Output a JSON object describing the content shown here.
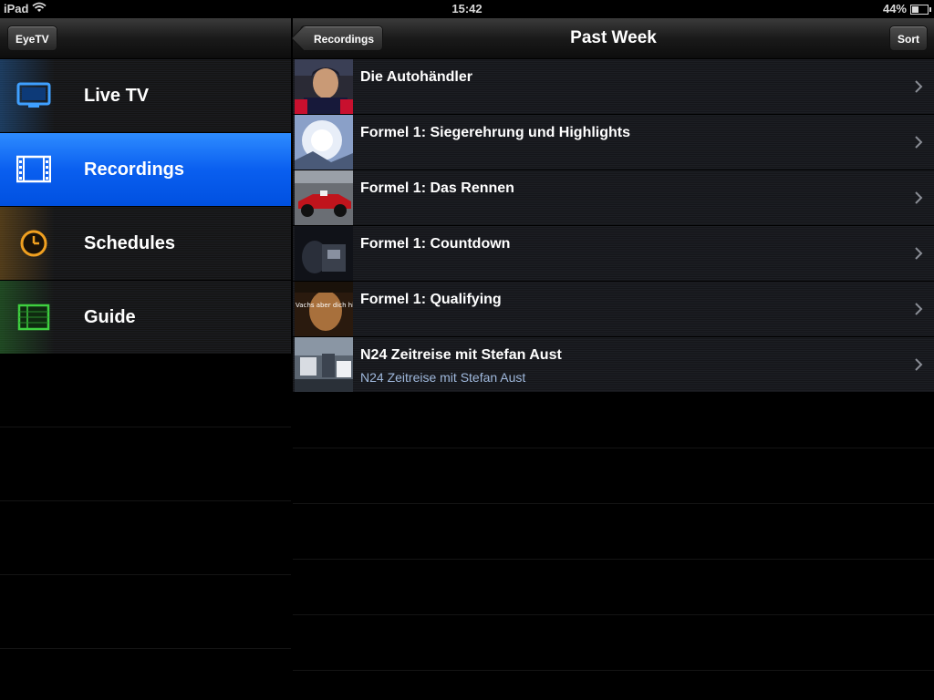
{
  "status_bar": {
    "device": "iPad",
    "time": "15:42",
    "battery": "44%",
    "battery_level": 0.44
  },
  "left_nav": {
    "button_label": "EyeTV"
  },
  "menu": [
    {
      "label": "Live TV",
      "icon": "tv-icon",
      "color": "#2a8fff"
    },
    {
      "label": "Recordings",
      "icon": "film-icon",
      "color": "#ffffff",
      "selected": true
    },
    {
      "label": "Schedules",
      "icon": "clock-icon",
      "color": "#e89a1a"
    },
    {
      "label": "Guide",
      "icon": "guide-grid-icon",
      "color": "#36c83a"
    }
  ],
  "right_nav": {
    "back_label": "Recordings",
    "title": "Past Week",
    "sort_label": "Sort"
  },
  "recordings": [
    {
      "title": "Die Autohändler",
      "subtitle": "",
      "thumb": "portrait-thumbnail"
    },
    {
      "title": "Formel 1: Siegerehrung und Highlights",
      "subtitle": "",
      "thumb": "celebration-thumbnail"
    },
    {
      "title": "Formel 1: Das Rennen",
      "subtitle": "",
      "thumb": "race-car-thumbnail"
    },
    {
      "title": "Formel 1: Countdown",
      "subtitle": "",
      "thumb": "countdown-thumbnail"
    },
    {
      "title": "Formel 1: Qualifying",
      "subtitle": "",
      "thumb": "qualifying-thumbnail",
      "thumb_text": "Vachs aber dich hinau"
    },
    {
      "title": "N24 Zeitreise mit Stefan Aust",
      "subtitle": "N24 Zeitreise mit Stefan Aust",
      "thumb": "news-thumbnail"
    }
  ]
}
